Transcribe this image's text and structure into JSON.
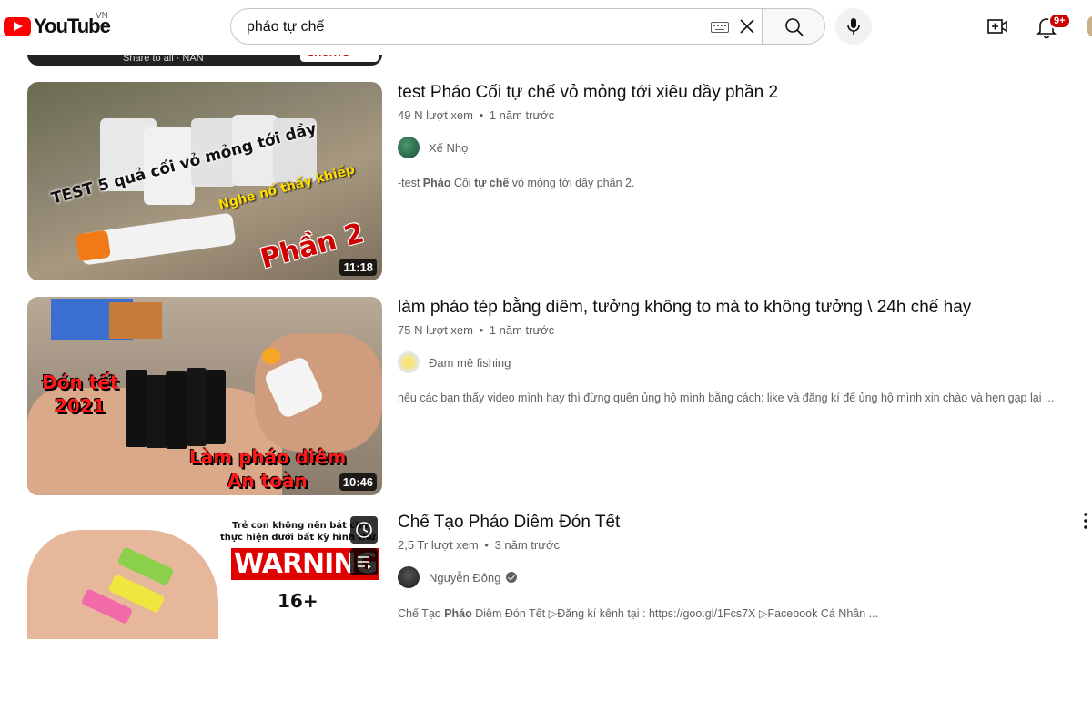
{
  "header": {
    "logo_text": "YouTube",
    "country": "VN",
    "search_value": "pháo tự chế",
    "notification_count": "9+"
  },
  "prev_item": {
    "share_text": "Share to all · NAN",
    "shorts_label": "SHORTS"
  },
  "results": [
    {
      "title": "test Pháo Cối tự chế vỏ mỏng tới xiêu dầy phần 2",
      "views": "49 N lượt xem",
      "age": "1 năm trước",
      "channel": "Xế Nhọ",
      "description_parts": [
        "-test ",
        "Pháo",
        " Cối ",
        "tự chế",
        " vỏ mỏng tới dầy phần 2."
      ],
      "duration": "11:18",
      "thumb_text": {
        "line1": "TEST 5 quả cối vỏ mỏng tới dầy",
        "line2": "Nghe nổ thấy khiếp",
        "line3": "Phần 2"
      }
    },
    {
      "title": "làm pháo tép bằng diêm, tưởng không to mà to không tưởng \\ 24h chế hay",
      "views": "75 N lượt xem",
      "age": "1 năm trước",
      "channel": "Đam mê fishing",
      "description": "nếu các bạn thấy video mình hay thì đừng quên ủng hộ mình bằng cách: like và đăng kí để ủng hộ mình xin chào và hẹn gạp lại ...",
      "duration": "10:46",
      "thumb_text": {
        "line1": "Đón tết",
        "line2": "2021",
        "line3": "Làm pháo diêm",
        "line4": "An toàn"
      }
    },
    {
      "title": "Chế Tạo Pháo Diêm Đón Tết",
      "views": "2,5 Tr lượt xem",
      "age": "3 năm trước",
      "channel": "Nguyễn Đông",
      "description_parts": [
        "Chế Tạo ",
        "Pháo",
        " Diêm Đón Tết ▷Đăng kí kênh tại : https://goo.gl/1Fcs7X ▷Facebook Cá Nhân ..."
      ],
      "thumb_text": {
        "line1": "Trẻ con không nên bắt chư",
        "line2": "thực hiện dưới bất kỳ hình thứ",
        "warning": "WARNING",
        "age": "16+"
      }
    }
  ],
  "meta_separator": "•",
  "colors": {
    "brand_red": "#ff0000",
    "badge_red": "#cc0000",
    "text_primary": "#0f0f0f",
    "text_secondary": "#606060"
  }
}
